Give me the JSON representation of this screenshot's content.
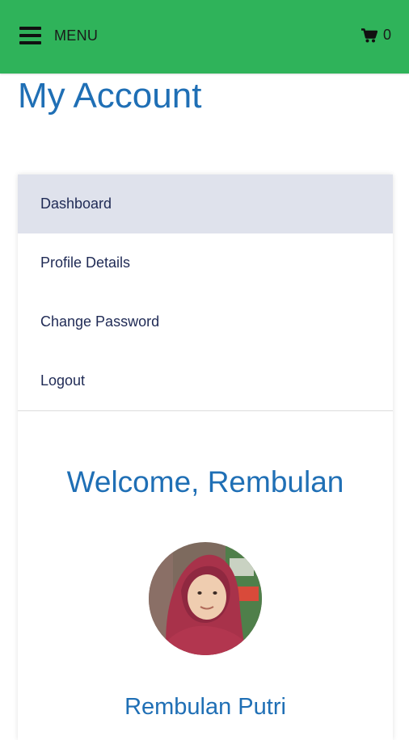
{
  "header": {
    "menu_label": "MENU",
    "cart_count": "0",
    "bg_color": "#2fb35a"
  },
  "page": {
    "title": "My Account"
  },
  "nav": {
    "items": [
      {
        "label": "Dashboard",
        "active": true
      },
      {
        "label": "Profile Details",
        "active": false
      },
      {
        "label": "Change Password",
        "active": false
      },
      {
        "label": "Logout",
        "active": false
      }
    ]
  },
  "dashboard": {
    "welcome": "Welcome, Rembulan",
    "user_name": "Rembulan Putri",
    "avatar_icon": "user-avatar-photo"
  },
  "colors": {
    "accent": "#1f6fb5",
    "active_nav_bg": "#dfe2ec",
    "nav_text": "#1f2a55"
  }
}
